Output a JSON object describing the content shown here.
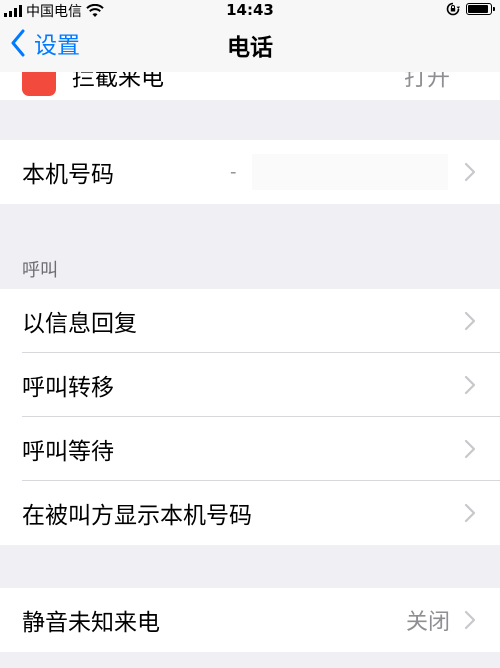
{
  "status_bar": {
    "carrier": "中国电信",
    "time": "14:43",
    "battery_level": 0.9
  },
  "nav": {
    "back_label": "设置",
    "title": "电话"
  },
  "partial_row": {
    "label": "拦截来电",
    "value": "打开"
  },
  "my_number": {
    "label": "本机号码",
    "value": "-"
  },
  "calls_section": {
    "header": "呼叫",
    "items": [
      {
        "label": "以信息回复"
      },
      {
        "label": "呼叫转移"
      },
      {
        "label": "呼叫等待"
      },
      {
        "label": "在被叫方显示本机号码"
      }
    ]
  },
  "silence": {
    "label": "静音未知来电",
    "value": "关闭"
  },
  "colors": {
    "accent": "#007aff",
    "background": "#efeff4",
    "secondary_text": "#8e8e93"
  }
}
